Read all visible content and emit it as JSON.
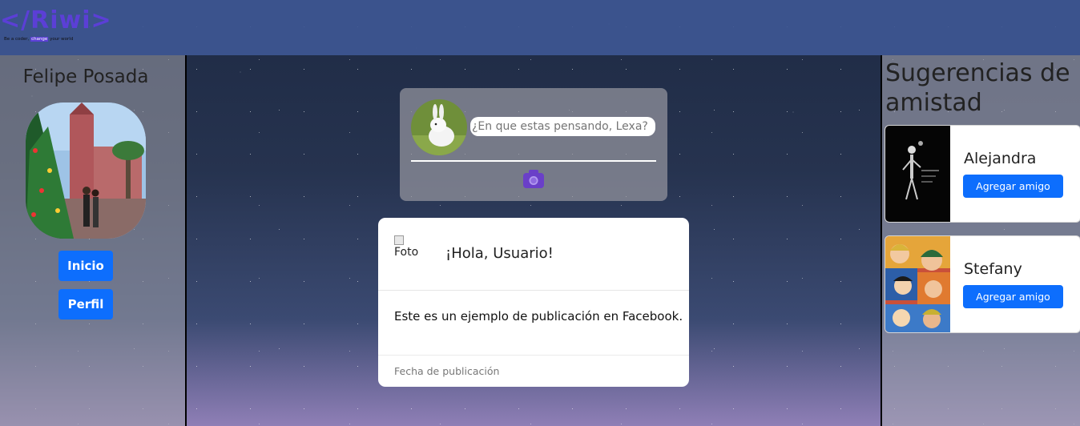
{
  "brand": {
    "logo_text": "</Riwi>",
    "tagline_before": "Be a coder,",
    "tagline_highlight": "change",
    "tagline_after": "your world"
  },
  "left_panel": {
    "user_name": "Felipe Posada",
    "nav": [
      {
        "label": "Inicio"
      },
      {
        "label": "Perfil"
      }
    ]
  },
  "composer": {
    "placeholder": "¿En que estas pensando, Lexa?",
    "camera_icon": "camera-icon"
  },
  "post": {
    "photo_alt": "Foto",
    "title": "¡Hola, Usuario!",
    "body": "Este es un ejemplo de publicación en Facebook.",
    "date": "Fecha de publicación"
  },
  "suggestions": {
    "title": "Sugerencias de amistad",
    "friends": [
      {
        "name": "Alejandra",
        "button": "Agregar amigo"
      },
      {
        "name": "Stefany",
        "button": "Agregar amigo"
      }
    ]
  },
  "colors": {
    "topbar": "#3e5794",
    "brand_purple": "#5b3fd6",
    "button_blue": "#0d6efd"
  }
}
